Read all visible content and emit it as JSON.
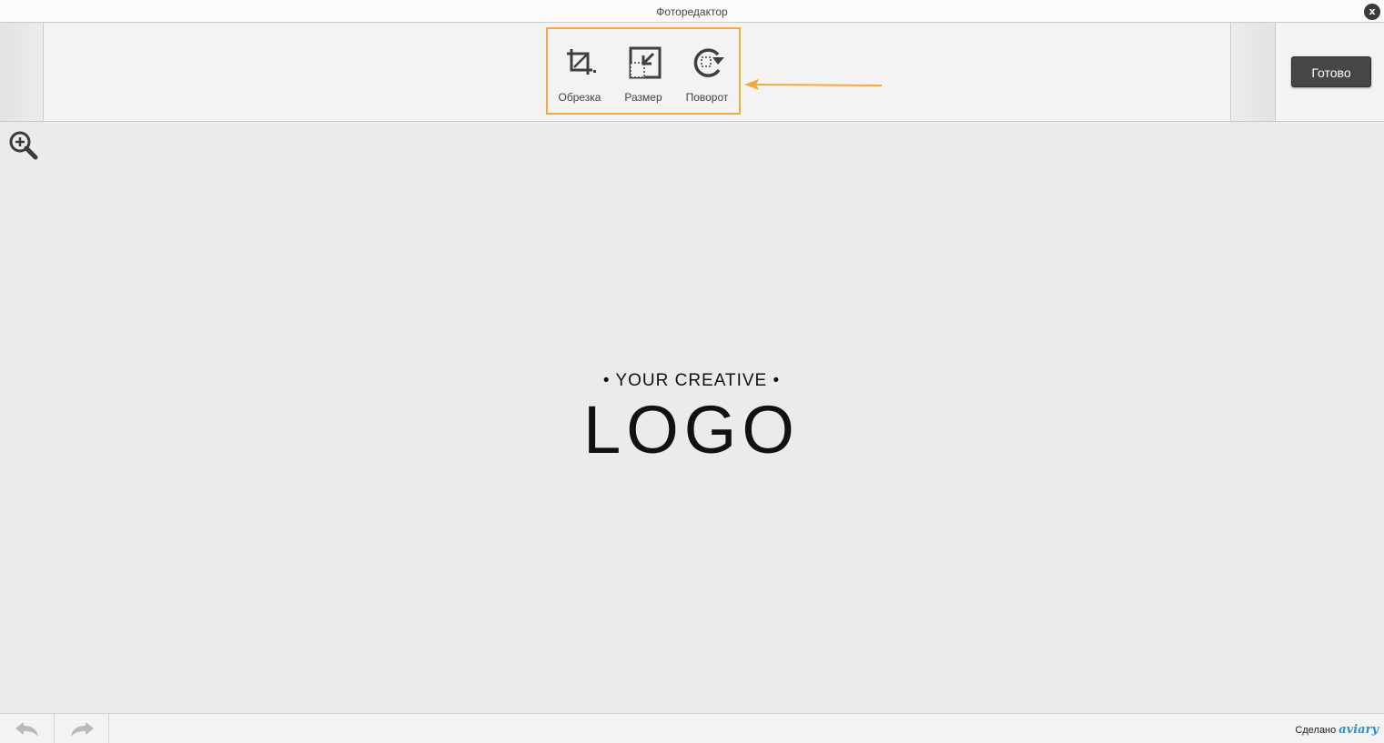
{
  "window": {
    "title": "Фоторедактор",
    "close_label": "x"
  },
  "toolbar": {
    "done_label": "Готово",
    "tools": [
      {
        "label": "Обрезка",
        "icon": "crop-icon"
      },
      {
        "label": "Размер",
        "icon": "resize-icon"
      },
      {
        "label": "Поворот",
        "icon": "rotate-icon"
      }
    ],
    "highlight_color": "#f5a742"
  },
  "canvas": {
    "logo_top": "• YOUR CREATIVE •",
    "logo_main": "LOGO"
  },
  "footer": {
    "powered_by": "Сделано",
    "brand": "aviary"
  }
}
